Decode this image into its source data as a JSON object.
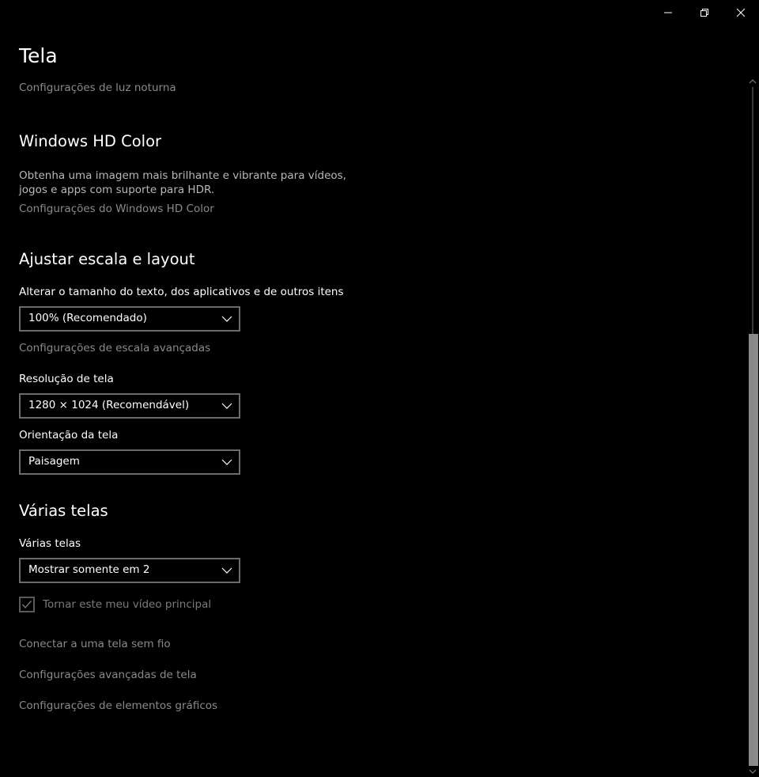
{
  "window": {
    "controls": {
      "minimize": "minimize",
      "restore": "restore",
      "close": "close"
    }
  },
  "page": {
    "title": "Tela",
    "night_light_link": "Configurações de luz noturna"
  },
  "hd_color": {
    "title": "Windows HD Color",
    "description": "Obtenha uma imagem mais brilhante e vibrante para vídeos, jogos e apps com suporte para HDR.",
    "settings_link": "Configurações do Windows HD Color"
  },
  "scale_layout": {
    "title": "Ajustar escala e layout",
    "scale_label": "Alterar o tamanho do texto, dos aplicativos e de outros itens",
    "scale_value": "100% (Recomendado)",
    "advanced_scaling_link": "Configurações de escala avançadas",
    "resolution_label": "Resolução de tela",
    "resolution_value": "1280 × 1024 (Recomendável)",
    "orientation_label": "Orientação da tela",
    "orientation_value": "Paisagem"
  },
  "multiple_displays": {
    "title": "Várias telas",
    "label": "Várias telas",
    "value": "Mostrar somente em 2",
    "main_display_checkbox": "Tornar este meu vídeo principal",
    "main_display_checked": true,
    "wireless_link": "Conectar a uma tela sem fio",
    "advanced_display_link": "Configurações avançadas de tela",
    "graphics_link": "Configurações de elementos gráficos"
  },
  "scrollbar": {
    "position_fraction": 0.37
  },
  "colors": {
    "background": "#000000",
    "text": "#ffffff",
    "link": "#8a8a8a",
    "border": "#6b6b6b"
  }
}
